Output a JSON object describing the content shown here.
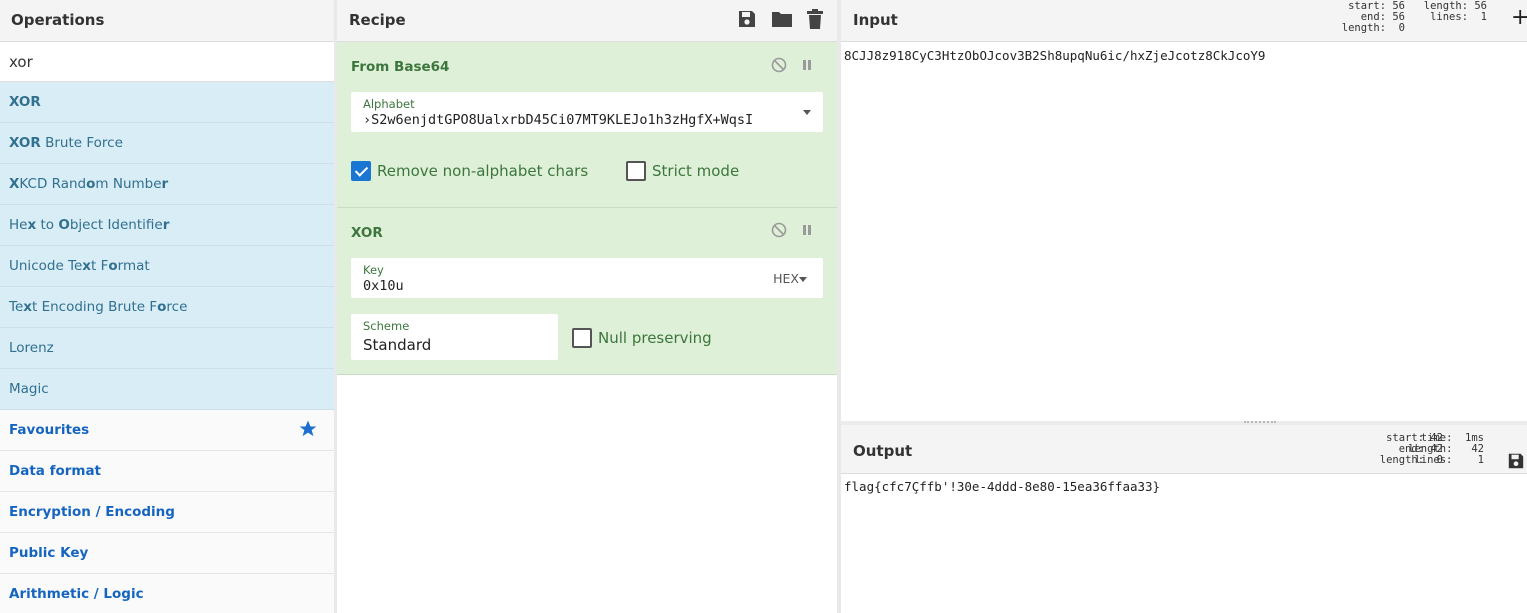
{
  "operations": {
    "title": "Operations",
    "search": {
      "value": "xor"
    },
    "results": [
      {
        "parts": [
          {
            "t": "XOR",
            "b": true
          }
        ]
      },
      {
        "parts": [
          {
            "t": "XOR",
            "b": true
          },
          {
            "t": " Brute Force",
            "b": false
          }
        ]
      },
      {
        "parts": [
          {
            "t": "X",
            "b": true
          },
          {
            "t": "KCD Rand",
            "b": false
          },
          {
            "t": "o",
            "b": true
          },
          {
            "t": "m Numbe",
            "b": false
          },
          {
            "t": "r",
            "b": true
          }
        ]
      },
      {
        "parts": [
          {
            "t": "He",
            "b": false
          },
          {
            "t": "x",
            "b": true
          },
          {
            "t": " to ",
            "b": false
          },
          {
            "t": "O",
            "b": true
          },
          {
            "t": "bject Identifie",
            "b": false
          },
          {
            "t": "r",
            "b": true
          }
        ]
      },
      {
        "parts": [
          {
            "t": "Unicode Te",
            "b": false
          },
          {
            "t": "x",
            "b": true
          },
          {
            "t": "t F",
            "b": false
          },
          {
            "t": "o",
            "b": true
          },
          {
            "t": "rmat",
            "b": false
          }
        ]
      },
      {
        "parts": [
          {
            "t": "Te",
            "b": false
          },
          {
            "t": "x",
            "b": true
          },
          {
            "t": "t Encoding Brute F",
            "b": false
          },
          {
            "t": "o",
            "b": true
          },
          {
            "t": "rce",
            "b": false
          }
        ]
      },
      {
        "parts": [
          {
            "t": "Lorenz",
            "b": false
          }
        ]
      },
      {
        "parts": [
          {
            "t": "Magic",
            "b": false
          }
        ]
      }
    ],
    "categories": [
      "Favourites",
      "Data format",
      "Encryption / Encoding",
      "Public Key",
      "Arithmetic / Logic"
    ]
  },
  "recipe": {
    "title": "Recipe",
    "from_base64": {
      "name": "From Base64",
      "alphabet_label": "Alphabet",
      "alphabet_value": "›S2w6enjdtGPO8UalxrbD45Ci07MT9KLEJo1h3zHgfX+WqsI",
      "remove_non_alphabet": {
        "label": "Remove non-alphabet chars",
        "checked": true
      },
      "strict_mode": {
        "label": "Strict mode",
        "checked": false
      }
    },
    "xor": {
      "name": "XOR",
      "key_label": "Key",
      "key_value": "0x10u",
      "key_format": "HEX",
      "scheme_label": "Scheme",
      "scheme_value": "Standard",
      "null_preserving": {
        "label": "Null preserving",
        "checked": false
      }
    }
  },
  "input": {
    "title": "Input",
    "stats_left": [
      "start: 56",
      "end: 56",
      "length:  0"
    ],
    "stats_right": [
      "length: 56",
      "lines:  1"
    ],
    "text": "8CJJ8z918CyC3HtzObOJcov3B2Sh8upqNu6ic/hxZjeJcotz8CkJcoY9"
  },
  "output": {
    "title": "Output",
    "stats_left": [
      "start: 42",
      "end: 42",
      "length:  0"
    ],
    "stats_right": [
      "time:  1ms",
      "length:   42",
      "lines:    1"
    ],
    "text": "flag{cfc7Çffb'!30e-4ddd-8e80-15ea36ffaa33}"
  }
}
